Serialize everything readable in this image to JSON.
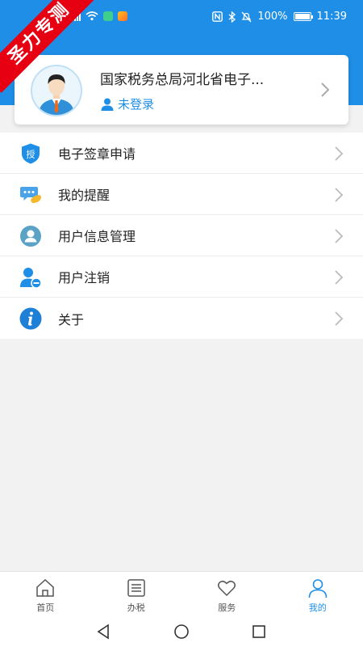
{
  "watermark": {
    "text": "圣力专测"
  },
  "status_bar": {
    "battery": "100%",
    "time": "11:39",
    "icons": [
      "signal-icon",
      "wifi-icon",
      "app-notification-icon",
      "nfc-icon",
      "bluetooth-icon",
      "mute-icon",
      "battery-icon"
    ]
  },
  "profile": {
    "org_name": "国家税务总局河北省电子...",
    "login_status": "未登录",
    "avatar_icon": "user-avatar-icon"
  },
  "menu": {
    "items": [
      {
        "label": "电子签章申请",
        "icon": "authorize-shield-icon",
        "icon_text": "授"
      },
      {
        "label": "我的提醒",
        "icon": "reminder-chat-icon"
      },
      {
        "label": "用户信息管理",
        "icon": "user-info-icon"
      },
      {
        "label": "用户注销",
        "icon": "user-remove-icon"
      },
      {
        "label": "关于",
        "icon": "info-icon"
      }
    ]
  },
  "tabs": [
    {
      "label": "首页",
      "icon": "home-icon",
      "active": false
    },
    {
      "label": "办税",
      "icon": "list-icon",
      "active": false
    },
    {
      "label": "服务",
      "icon": "heart-icon",
      "active": false
    },
    {
      "label": "我的",
      "icon": "person-icon",
      "active": true
    }
  ],
  "colors": {
    "primary": "#1e8ee6",
    "watermark": "#e60012",
    "background": "#f2f2f2"
  }
}
